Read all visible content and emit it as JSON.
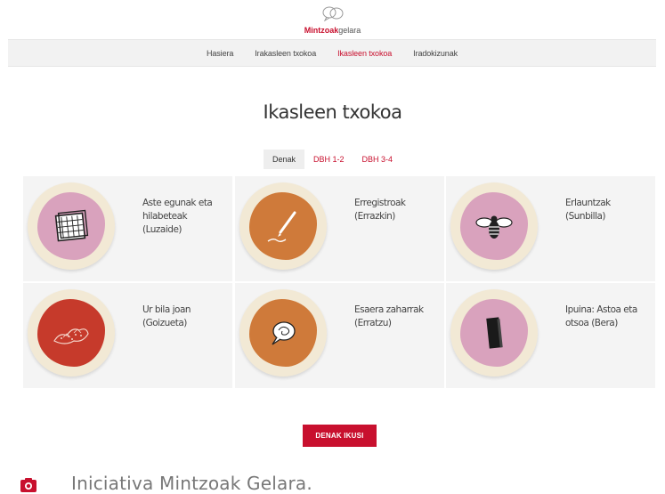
{
  "brand": {
    "logo_part1": "Mintzoak",
    "logo_part2": "gelara",
    "accent": "#c8102e"
  },
  "nav": {
    "items": [
      {
        "label": "Hasiera",
        "active": false
      },
      {
        "label": "Irakasleen txokoa",
        "active": false
      },
      {
        "label": "Ikasleen txokoa",
        "active": true
      },
      {
        "label": "Iradokizunak",
        "active": false
      }
    ]
  },
  "page": {
    "title": "Ikasleen txokoa"
  },
  "filters": [
    {
      "label": "Denak",
      "active": true
    },
    {
      "label": "DBH 1-2",
      "active": false
    },
    {
      "label": "DBH 3-4",
      "active": false
    }
  ],
  "cards": [
    {
      "title": "Aste egunak eta hilabeteak (Luzaide)",
      "blob_color": "#d9a2bd",
      "icon": "calendar-icon"
    },
    {
      "title": "Erregistroak (Errazkin)",
      "blob_color": "#cf7a3a",
      "icon": "pencil-icon"
    },
    {
      "title": "Erlauntzak (Sunbilla)",
      "blob_color": "#d9a2bd",
      "icon": "bee-icon"
    },
    {
      "title": "Ur bila joan (Goizueta)",
      "blob_color": "#c63a2b",
      "icon": "map-icon"
    },
    {
      "title": "Esaera zaharrak (Erratzu)",
      "blob_color": "#cf7a3a",
      "icon": "speech-bubble-icon"
    },
    {
      "title": "Ipuina: Astoa eta otsoa (Bera)",
      "blob_color": "#d9a2bd",
      "icon": "book-icon"
    }
  ],
  "actions": {
    "see_all": "DENAK IKUSI"
  },
  "footer": {
    "text": "Iniciativa Mintzoak Gelara.",
    "icon": "camera-icon"
  }
}
